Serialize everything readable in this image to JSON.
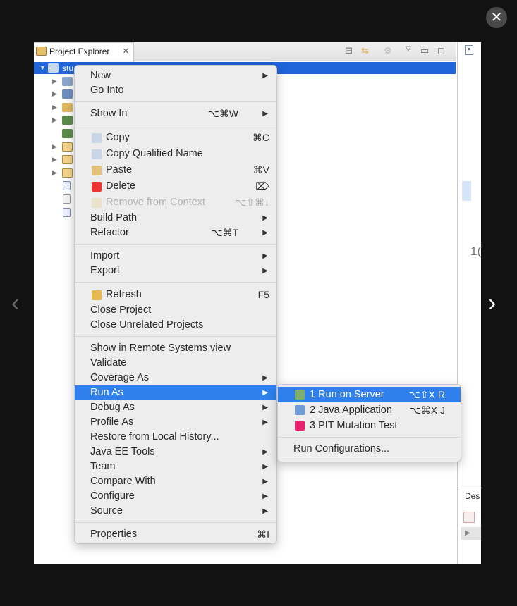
{
  "viewer": {
    "close_icon": "✕",
    "prev_icon": "‹",
    "next_icon": "›"
  },
  "explorer": {
    "tab_title": "Project Explorer",
    "tab_close": "✕",
    "project_label": "stu",
    "toolbar_icons": [
      "collapse-all-icon",
      "link-with-editor-icon",
      "filter-icon",
      "view-menu-icon",
      "minimize-icon",
      "maximize-icon"
    ],
    "selection_color": "#1f64d9"
  },
  "right_pane": {
    "tab_icon": "X",
    "number_fragment": "1(",
    "bottom_tab": "Des"
  },
  "context_menu": {
    "groups": [
      [
        {
          "label": "New",
          "submenu": true
        },
        {
          "label": "Go Into"
        }
      ],
      [
        {
          "label": "Show In",
          "shortcut": "⌥⌘W",
          "submenu": true
        }
      ],
      [
        {
          "label": "Copy",
          "shortcut": "⌘C",
          "icon": "copy-icon"
        },
        {
          "label": "Copy Qualified Name",
          "icon": "copy-qualified-name-icon"
        },
        {
          "label": "Paste",
          "shortcut": "⌘V",
          "icon": "paste-icon"
        },
        {
          "label": "Delete",
          "shortcut": "⌦",
          "icon": "delete-icon"
        },
        {
          "label": "Remove from Context",
          "shortcut": "⌥⇧⌘↓",
          "icon": "remove-context-icon",
          "disabled": true
        },
        {
          "label": "Build Path",
          "submenu": true
        },
        {
          "label": "Refactor",
          "shortcut": "⌥⌘T",
          "submenu": true
        }
      ],
      [
        {
          "label": "Import",
          "submenu": true
        },
        {
          "label": "Export",
          "submenu": true
        }
      ],
      [
        {
          "label": "Refresh",
          "shortcut": "F5",
          "icon": "refresh-icon"
        },
        {
          "label": "Close Project"
        },
        {
          "label": "Close Unrelated Projects"
        }
      ],
      [
        {
          "label": "Show in Remote Systems view"
        },
        {
          "label": "Validate"
        },
        {
          "label": "Coverage As",
          "submenu": true
        },
        {
          "label": "Run As",
          "submenu": true,
          "highlighted": true
        },
        {
          "label": "Debug As",
          "submenu": true
        },
        {
          "label": "Profile As",
          "submenu": true
        },
        {
          "label": "Restore from Local History..."
        },
        {
          "label": "Java EE Tools",
          "submenu": true
        },
        {
          "label": "Team",
          "submenu": true
        },
        {
          "label": "Compare With",
          "submenu": true
        },
        {
          "label": "Configure",
          "submenu": true
        },
        {
          "label": "Source",
          "submenu": true
        }
      ],
      [
        {
          "label": "Properties",
          "shortcut": "⌘I"
        }
      ]
    ],
    "highlight_color": "#2f80ed"
  },
  "run_as_submenu": {
    "items": [
      {
        "label": "1 Run on Server",
        "shortcut": "⌥⇧X R",
        "icon": "run-on-server-icon",
        "highlighted": true
      },
      {
        "label": "2 Java Application",
        "shortcut": "⌥⌘X J",
        "icon": "java-application-icon"
      },
      {
        "label": "3 PIT Mutation Test",
        "icon": "pit-mutation-icon"
      }
    ],
    "footer": "Run Configurations..."
  }
}
